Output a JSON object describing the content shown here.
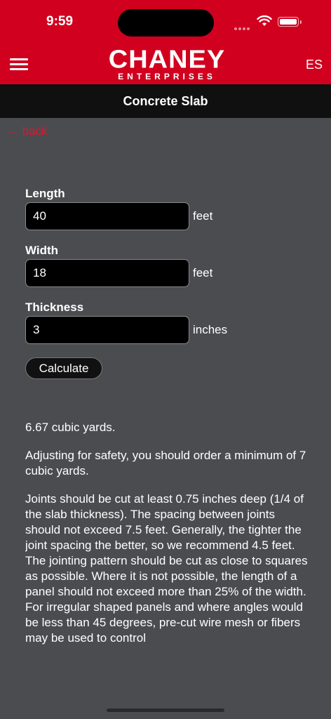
{
  "status": {
    "time": "9:59"
  },
  "appbar": {
    "logo_main": "CHANEY",
    "logo_sub": "ENTERPRISES",
    "lang": "ES",
    "menu_icon": "hamburger-menu-icon"
  },
  "page": {
    "title": "Concrete Slab",
    "back_label": "← back"
  },
  "form": {
    "length": {
      "label": "Length",
      "value": "40",
      "unit": "feet"
    },
    "width": {
      "label": "Width",
      "value": "18",
      "unit": "feet"
    },
    "thickness": {
      "label": "Thickness",
      "value": "3",
      "unit": "inches"
    },
    "calculate_label": "Calculate"
  },
  "results": {
    "volume": "6.67 cubic yards.",
    "order": "Adjusting for safety, you should order a minimum of 7 cubic yards.",
    "joints": "Joints should be cut at least 0.75 inches deep (1/4 of the slab thickness). The spacing between joints should not exceed 7.5 feet. Generally, the tighter the joint spacing the better, so we recommend 4.5 feet. The jointing pattern should be cut as close to squares as possible. Where it is not possible, the length of a panel should not exceed more than 25% of the width. For irregular shaped panels and where angles would be less than 45 degrees, pre-cut wire mesh or fibers may be used to control"
  },
  "colors": {
    "brand_red": "#d1001f",
    "background": "#4a4c50",
    "titlebar": "#101010",
    "link_red": "#e0162b"
  }
}
